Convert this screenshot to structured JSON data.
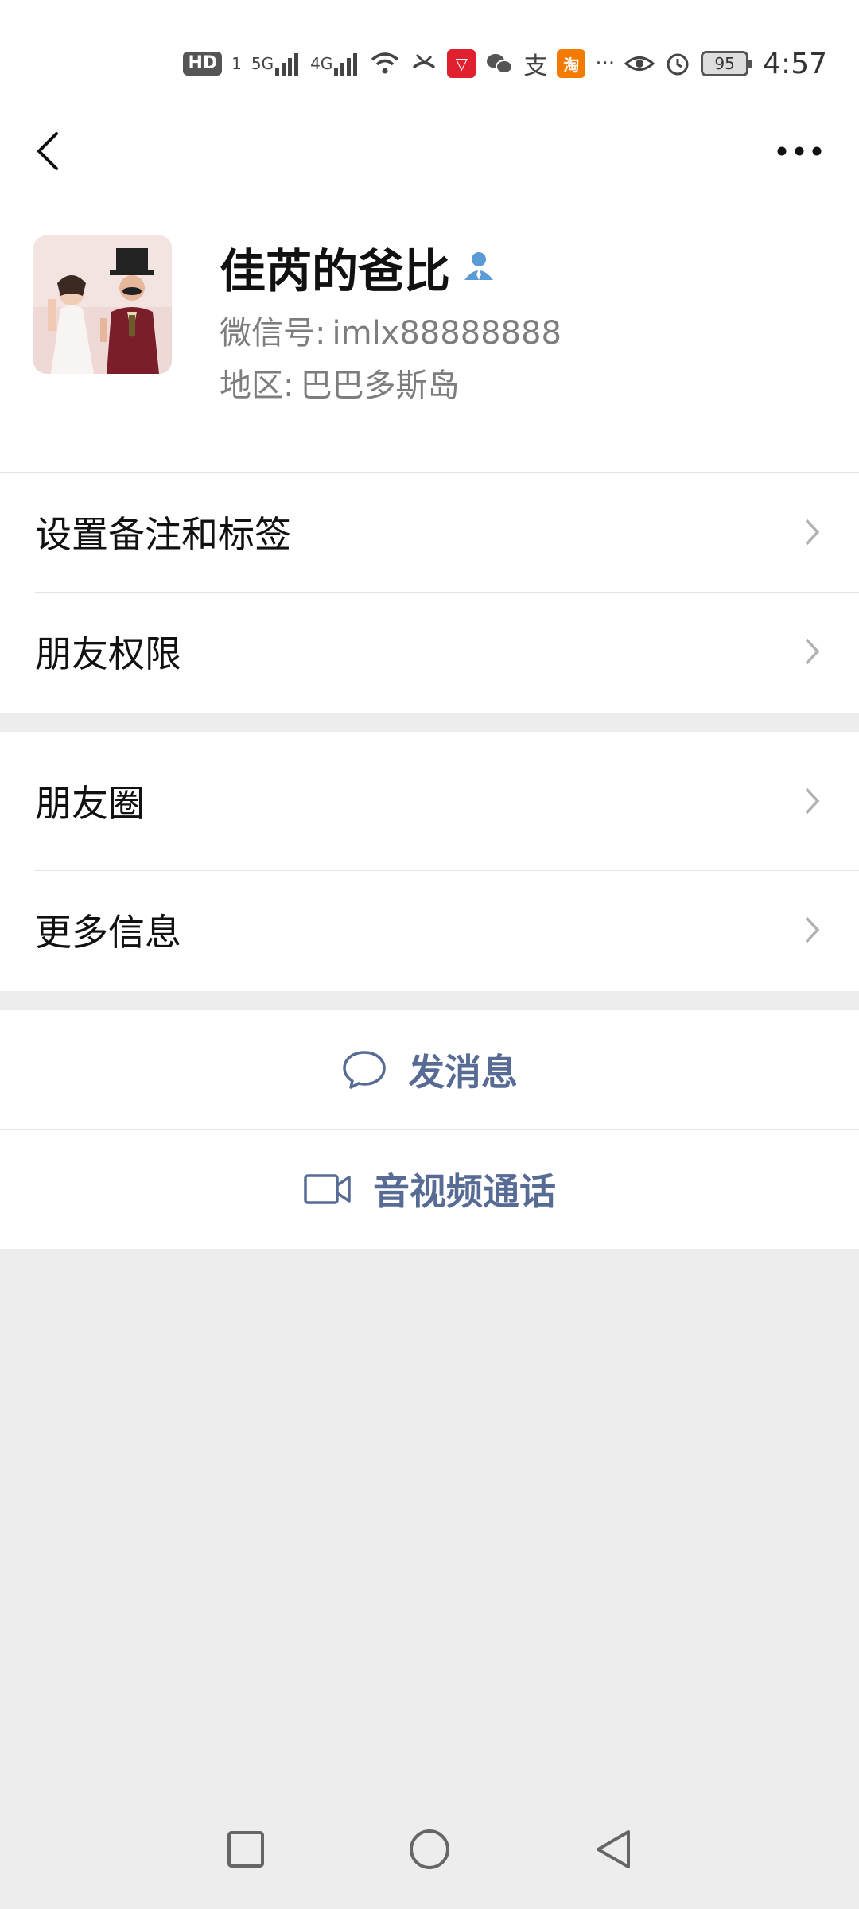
{
  "status_bar": {
    "hd": "HD",
    "sim": "1",
    "net1": "5G",
    "net2": "4G",
    "taobao": "淘",
    "alipay": "支",
    "more": "···",
    "battery": "95",
    "time": "4:57"
  },
  "nav": {
    "back_icon": "chevron-left-icon",
    "more_icon": "more-horizontal-icon"
  },
  "profile": {
    "name": "佳芮的爸比",
    "wechat_id_label": "微信号:",
    "wechat_id": "imlx88888888",
    "region_label": "地区:",
    "region": "巴巴多斯岛"
  },
  "menu_group_1": [
    {
      "label": "设置备注和标签"
    },
    {
      "label": "朋友权限"
    }
  ],
  "menu_group_2": [
    {
      "label": "朋友圈"
    },
    {
      "label": "更多信息"
    }
  ],
  "actions": {
    "send_message": "发消息",
    "video_call": "音视频通话"
  },
  "colors": {
    "accent": "#576b95",
    "background": "#ededed",
    "card": "#ffffff",
    "verified_icon": "#5b9bd5"
  }
}
